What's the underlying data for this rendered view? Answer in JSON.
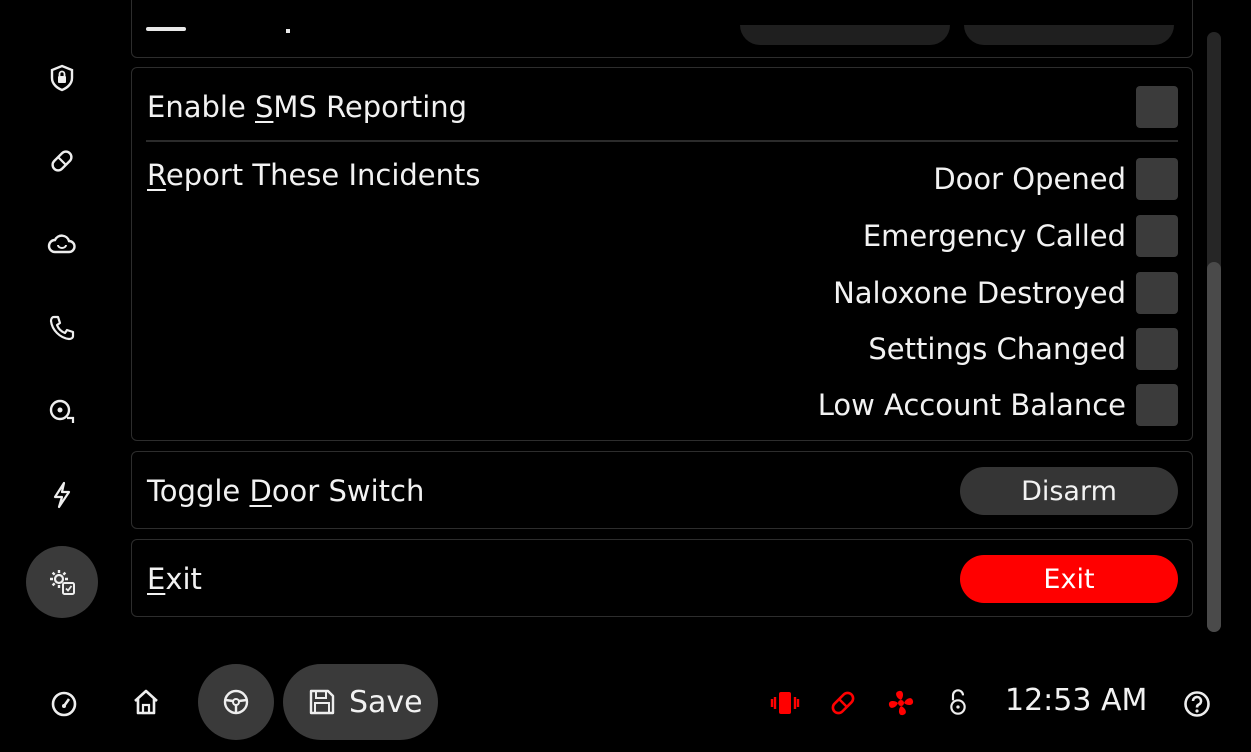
{
  "nav": {
    "items": [
      {
        "name": "security"
      },
      {
        "name": "medication"
      },
      {
        "name": "cloud"
      },
      {
        "name": "phone"
      },
      {
        "name": "alarm"
      },
      {
        "name": "power"
      },
      {
        "name": "settings",
        "active": true
      }
    ]
  },
  "sms": {
    "enable_label_pre": "Enable ",
    "enable_label_key": "S",
    "enable_label_post": "MS Reporting",
    "enable_checked": false,
    "report_label_key": "R",
    "report_label_post": "eport These Incidents",
    "incidents": [
      {
        "label": "Door Opened",
        "checked": false
      },
      {
        "label": "Emergency Called",
        "checked": false
      },
      {
        "label": "Naloxone Destroyed",
        "checked": false
      },
      {
        "label": "Settings Changed",
        "checked": false
      },
      {
        "label": "Low Account Balance",
        "checked": false
      }
    ]
  },
  "door": {
    "label_pre": "Toggle ",
    "label_key": "D",
    "label_post": "oor Switch",
    "button_label": "Disarm"
  },
  "exit": {
    "label_key": "E",
    "label_post": "xit",
    "button_label": "Exit"
  },
  "bottom_bar": {
    "save_label": "Save",
    "time": "12:53 AM"
  },
  "colors": {
    "accent_red": "#ff0000",
    "checkbox": "#3b3b3b",
    "button_grey": "#353535",
    "background": "#000000"
  }
}
